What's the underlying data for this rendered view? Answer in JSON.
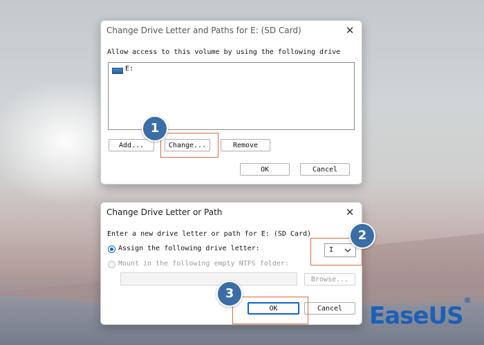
{
  "dialog1": {
    "title": "Change Drive Letter and Paths for E: (SD Card)",
    "close_glyph": "✕",
    "instruction": "Allow access to this volume by using the following drive",
    "list_items": [
      {
        "icon": "drive-icon",
        "label": "E:"
      }
    ],
    "buttons": {
      "add": "Add...",
      "change": "Change...",
      "remove": "Remove",
      "ok": "OK",
      "cancel": "Cancel"
    }
  },
  "dialog2": {
    "title": "Change Drive Letter or Path",
    "close_glyph": "✕",
    "instruction": "Enter a new drive letter or path for E: (SD Card)",
    "option_assign": "Assign the following drive letter:",
    "option_mount": "Mount in the following empty NTFS folder:",
    "selected_letter": "I",
    "browse": "Browse...",
    "ok": "OK",
    "cancel": "Cancel",
    "assign_selected": true
  },
  "steps": [
    "1",
    "2",
    "3"
  ],
  "brand": {
    "name": "EaseUS",
    "mark": "®"
  },
  "colors": {
    "accent": "#0a64c8",
    "highlight": "#d66a3e",
    "badge": "#3b6da6",
    "brand": "#1c5fb6"
  }
}
